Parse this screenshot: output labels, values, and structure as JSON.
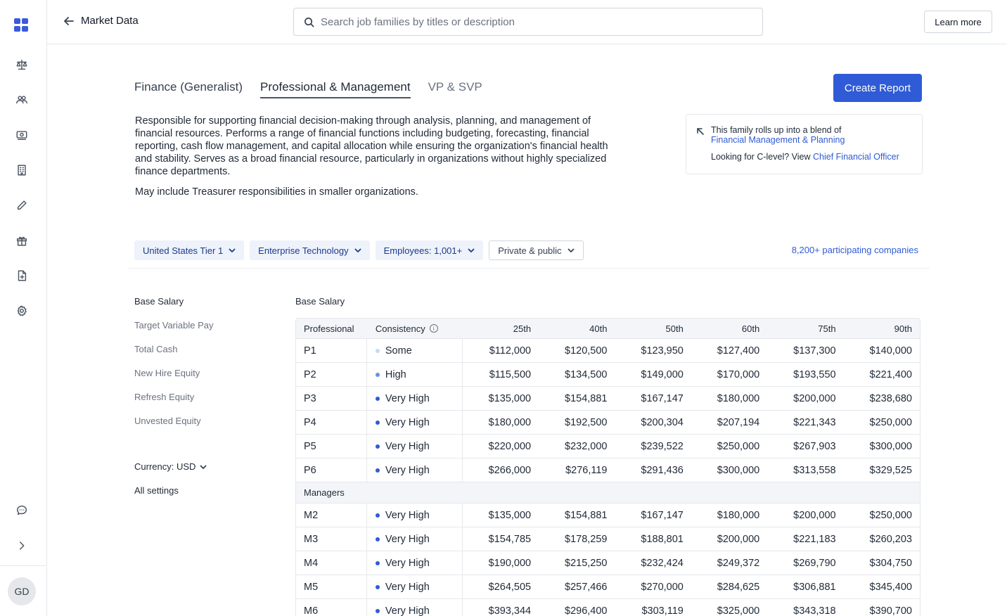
{
  "header": {
    "back_label": "Market Data",
    "search_placeholder": "Search job families by titles or description",
    "learn_more": "Learn more"
  },
  "user": {
    "initials": "GD"
  },
  "tabs": [
    {
      "label": "Finance (Generalist)"
    },
    {
      "label": "Professional & Management"
    },
    {
      "label": "VP & SVP"
    }
  ],
  "create_report": "Create Report",
  "description": {
    "p1": "Responsible for supporting financial decision-making through analysis, planning, and management of financial resources. Performs a range of financial functions including budgeting, forecasting, financial reporting, cash flow management, and capital allocation while ensuring the organization's financial health and stability. Serves as a broad financial resource, particularly in organizations without highly specialized finance departments.",
    "p2": "May include Treasurer responsibilities in smaller organizations."
  },
  "info": {
    "line1": "This family rolls up into a blend of",
    "link1": "Financial Management & Planning",
    "line2_prefix": "Looking for C-level? View",
    "link2": "Chief Financial Officer"
  },
  "filters": [
    {
      "label": "United States Tier 1"
    },
    {
      "label": "Enterprise Technology"
    },
    {
      "label": "Employees: 1,001+"
    },
    {
      "label": "Private & public"
    }
  ],
  "participating": "8,200+ participating companies",
  "sidenav": [
    {
      "label": "Base Salary"
    },
    {
      "label": "Target Variable Pay"
    },
    {
      "label": "Total Cash"
    },
    {
      "label": "New Hire Equity"
    },
    {
      "label": "Refresh Equity"
    },
    {
      "label": "Unvested Equity"
    }
  ],
  "currency": "Currency: USD",
  "all_settings": "All settings",
  "table": {
    "title": "Base Salary",
    "columns": [
      "Professional",
      "Consistency",
      "25th",
      "40th",
      "50th",
      "60th",
      "75th",
      "90th"
    ],
    "professional_rows": [
      {
        "level": "P1",
        "consistency": "Some",
        "values": [
          "$112,000",
          "$120,500",
          "$123,950",
          "$127,400",
          "$137,300",
          "$140,000"
        ]
      },
      {
        "level": "P2",
        "consistency": "High",
        "values": [
          "$115,500",
          "$134,500",
          "$149,000",
          "$170,000",
          "$193,550",
          "$221,400"
        ]
      },
      {
        "level": "P3",
        "consistency": "Very High",
        "values": [
          "$135,000",
          "$154,881",
          "$167,147",
          "$180,000",
          "$200,000",
          "$238,680"
        ]
      },
      {
        "level": "P4",
        "consistency": "Very High",
        "values": [
          "$180,000",
          "$192,500",
          "$200,304",
          "$207,194",
          "$221,343",
          "$250,000"
        ]
      },
      {
        "level": "P5",
        "consistency": "Very High",
        "values": [
          "$220,000",
          "$232,000",
          "$239,522",
          "$250,000",
          "$267,903",
          "$300,000"
        ]
      },
      {
        "level": "P6",
        "consistency": "Very High",
        "values": [
          "$266,000",
          "$276,119",
          "$291,436",
          "$300,000",
          "$313,558",
          "$329,525"
        ]
      }
    ],
    "group_label": "Managers",
    "manager_rows": [
      {
        "level": "M2",
        "consistency": "Very High",
        "values": [
          "$135,000",
          "$154,881",
          "$167,147",
          "$180,000",
          "$200,000",
          "$250,000"
        ]
      },
      {
        "level": "M3",
        "consistency": "Very High",
        "values": [
          "$154,785",
          "$178,259",
          "$188,801",
          "$200,000",
          "$221,183",
          "$260,203"
        ]
      },
      {
        "level": "M4",
        "consistency": "Very High",
        "values": [
          "$190,000",
          "$215,250",
          "$232,424",
          "$249,372",
          "$269,790",
          "$304,750"
        ]
      },
      {
        "level": "M5",
        "consistency": "Very High",
        "values": [
          "$264,505",
          "$257,466",
          "$270,000",
          "$284,625",
          "$306,881",
          "$345,400"
        ]
      },
      {
        "level": "M6",
        "consistency": "Very High",
        "values": [
          "$393,344",
          "$296,400",
          "$303,119",
          "$325,000",
          "$343,318",
          "$390,700"
        ]
      }
    ]
  },
  "colors": {
    "accent": "#2f5bd6",
    "chip_bg": "#eef2fb"
  }
}
